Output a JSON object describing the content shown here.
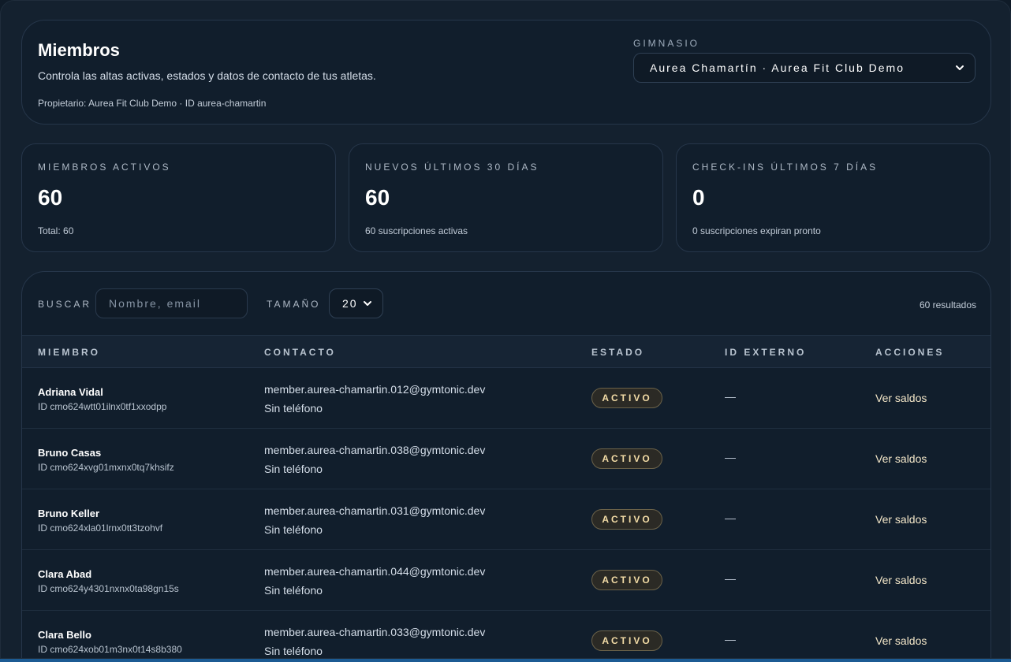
{
  "header": {
    "title": "Miembros",
    "subtitle": "Controla las altas activas, estados y datos de contacto de tus atletas.",
    "owner_line": "Propietario: Aurea Fit Club Demo · ID aurea-chamartin",
    "gym_label": "Gimnasio",
    "gym_selected": "Aurea Chamartín · Aurea Fit Club Demo"
  },
  "stats": [
    {
      "label": "Miembros activos",
      "value": "60",
      "note": "Total: 60"
    },
    {
      "label": "Nuevos últimos 30 días",
      "value": "60",
      "note": "60 suscripciones activas"
    },
    {
      "label": "Check-ins últimos 7 días",
      "value": "0",
      "note": "0 suscripciones expiran pronto"
    }
  ],
  "toolbar": {
    "search_label": "Buscar",
    "search_placeholder": "Nombre, email",
    "size_label": "Tamaño",
    "size_selected": "20",
    "results": "60 resultados"
  },
  "table": {
    "columns": [
      "Miembro",
      "Contacto",
      "Estado",
      "ID externo",
      "Acciones"
    ],
    "rows": [
      {
        "name": "Adriana Vidal",
        "id": "ID cmo624wtt01ilnx0tf1xxodpp",
        "email": "member.aurea-chamartin.012@gymtonic.dev",
        "phone": "Sin teléfono",
        "status": "Activo",
        "external_id": "—",
        "action": "Ver saldos"
      },
      {
        "name": "Bruno Casas",
        "id": "ID cmo624xvg01mxnx0tq7khsifz",
        "email": "member.aurea-chamartin.038@gymtonic.dev",
        "phone": "Sin teléfono",
        "status": "Activo",
        "external_id": "—",
        "action": "Ver saldos"
      },
      {
        "name": "Bruno Keller",
        "id": "ID cmo624xla01lrnx0tt3tzohvf",
        "email": "member.aurea-chamartin.031@gymtonic.dev",
        "phone": "Sin teléfono",
        "status": "Activo",
        "external_id": "—",
        "action": "Ver saldos"
      },
      {
        "name": "Clara Abad",
        "id": "ID cmo624y4301nxnx0ta98gn15s",
        "email": "member.aurea-chamartin.044@gymtonic.dev",
        "phone": "Sin teléfono",
        "status": "Activo",
        "external_id": "—",
        "action": "Ver saldos"
      },
      {
        "name": "Clara Bello",
        "id": "ID cmo624xob01m3nx0t14s8b380",
        "email": "member.aurea-chamartin.033@gymtonic.dev",
        "phone": "Sin teléfono",
        "status": "Activo",
        "external_id": "—",
        "action": "Ver saldos"
      }
    ]
  },
  "colors": {
    "background": "#14212f",
    "card": "#111e2c",
    "accent_badge": "#f3dca6",
    "bottom_bar": "#1c5b93"
  },
  "icons": {
    "select_arrow": "chevron-down-icon"
  }
}
